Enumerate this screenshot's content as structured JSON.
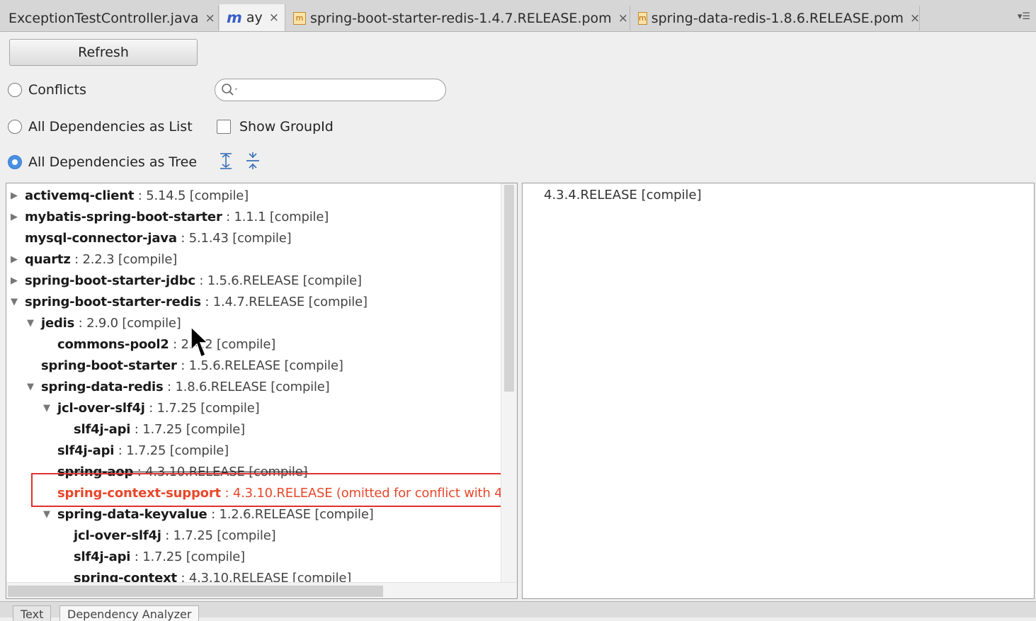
{
  "tabs": [
    {
      "label": "ExceptionTestController.java",
      "icon": "java-file-icon"
    },
    {
      "label": "ay",
      "icon": "maven-m-icon"
    },
    {
      "label": "spring-boot-starter-redis-1.4.7.RELEASE.pom",
      "icon": "pom-file-icon"
    },
    {
      "label": "spring-data-redis-1.8.6.RELEASE.pom",
      "icon": "pom-file-icon"
    }
  ],
  "tab_close_glyph": "×",
  "tab_menu_glyph": "▾☰",
  "toolbar": {
    "refresh_label": "Refresh",
    "conflicts_label": "Conflicts",
    "list_label": "All Dependencies as List",
    "tree_label": "All Dependencies as Tree",
    "show_groupid_label": "Show GroupId",
    "selected_view": "All Dependencies as Tree",
    "show_groupid_checked": false,
    "search_value": ""
  },
  "tree": [
    {
      "name": "activemq-client",
      "version": " : 5.14.5 [compile]",
      "level": 0,
      "toggle": "▶",
      "state": "normal"
    },
    {
      "name": "mybatis-spring-boot-starter",
      "version": " : 1.1.1 [compile]",
      "level": 0,
      "toggle": "▶",
      "state": "normal"
    },
    {
      "name": "mysql-connector-java",
      "version": " : 5.1.43 [compile]",
      "level": 0,
      "toggle": "",
      "state": "normal"
    },
    {
      "name": "quartz",
      "version": " : 2.2.3 [compile]",
      "level": 0,
      "toggle": "▶",
      "state": "normal"
    },
    {
      "name": "spring-boot-starter-jdbc",
      "version": " : 1.5.6.RELEASE [compile]",
      "level": 0,
      "toggle": "▶",
      "state": "normal"
    },
    {
      "name": "spring-boot-starter-redis",
      "version": " : 1.4.7.RELEASE [compile]",
      "level": 0,
      "toggle": "▼",
      "state": "normal"
    },
    {
      "name": "jedis",
      "version": " : 2.9.0 [compile]",
      "level": 1,
      "toggle": "▼",
      "state": "normal"
    },
    {
      "name": "commons-pool2",
      "version": " : 2.4.2 [compile]",
      "level": 2,
      "toggle": "",
      "state": "normal"
    },
    {
      "name": "spring-boot-starter",
      "version": " : 1.5.6.RELEASE [compile]",
      "level": 1,
      "toggle": "",
      "state": "normal"
    },
    {
      "name": "spring-data-redis",
      "version": " : 1.8.6.RELEASE [compile]",
      "level": 1,
      "toggle": "▼",
      "state": "normal"
    },
    {
      "name": "jcl-over-slf4j",
      "version": " : 1.7.25 [compile]",
      "level": 2,
      "toggle": "▼",
      "state": "normal"
    },
    {
      "name": "slf4j-api",
      "version": " : 1.7.25 [compile]",
      "level": 3,
      "toggle": "",
      "state": "normal"
    },
    {
      "name": "slf4j-api",
      "version": " : 1.7.25 [compile]",
      "level": 2,
      "toggle": "",
      "state": "normal"
    },
    {
      "name": "spring-aop",
      "version": " : 4.3.10.RELEASE [compile]",
      "level": 2,
      "toggle": "",
      "state": "strike"
    },
    {
      "name": "spring-context-support",
      "version": " : 4.3.10.RELEASE (omitted for conflict with 4",
      "level": 2,
      "toggle": "",
      "state": "conflict"
    },
    {
      "name": "spring-data-keyvalue",
      "version": " : 1.2.6.RELEASE [compile]",
      "level": 2,
      "toggle": "▼",
      "state": "normal"
    },
    {
      "name": "jcl-over-slf4j",
      "version": " : 1.7.25 [compile]",
      "level": 3,
      "toggle": "",
      "state": "normal"
    },
    {
      "name": "slf4j-api",
      "version": " : 1.7.25 [compile]",
      "level": 3,
      "toggle": "",
      "state": "normal"
    },
    {
      "name": "spring-context",
      "version": " : 4.3.10.RELEASE [compile]",
      "level": 3,
      "toggle": "",
      "state": "normal"
    }
  ],
  "detail": {
    "text": "4.3.4.RELEASE [compile]"
  },
  "bottom_tabs": [
    {
      "label": "Text"
    },
    {
      "label": "Dependency Analyzer"
    }
  ],
  "colors": {
    "conflict": "#e8472a",
    "highlight_box": "#e0302f",
    "radio_selected": "#4a90e2"
  }
}
